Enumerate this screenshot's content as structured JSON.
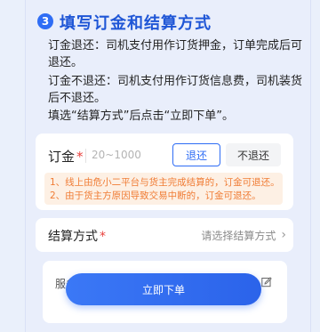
{
  "step": {
    "number": "3",
    "title": "填写订金和结算方式"
  },
  "explanation": {
    "refund_text": "订金退还：司机支付用作订货押金，订单完成后可退还。",
    "no_refund_text": "订金不退还：司机支付用作订货信息费，司机装货后不退还。",
    "instruction_text": "填选“结算方式”后点击“立即下单”。"
  },
  "deposit": {
    "label": "订金",
    "required_mark": "*",
    "placeholder": "20~1000",
    "value": "",
    "refund_option": "退还",
    "no_refund_option": "不退还",
    "selected_option": "退还"
  },
  "notice": {
    "line1": "1、线上由危小二平台与货主完成结算的，订金可退还。",
    "line2": "2、由于货主方原因导致交易中断的，订金可退还。"
  },
  "settlement": {
    "label": "结算方式",
    "required_mark": "*",
    "placeholder": "请选择结算方式",
    "chevron": "›"
  },
  "service": {
    "partial_label": "服务"
  },
  "order_button": {
    "label": "立即下单"
  },
  "colors": {
    "accent": "#2f6df5",
    "title": "#1f56d6",
    "warning_text": "#f07c35",
    "warning_bg": "#fdf0e4",
    "required": "#e8413d",
    "background": "#e9eefb"
  },
  "icons": {
    "step": "step-number-icon",
    "settlement_chevron": "chevron-right-icon",
    "service_edit": "edit-icon"
  }
}
